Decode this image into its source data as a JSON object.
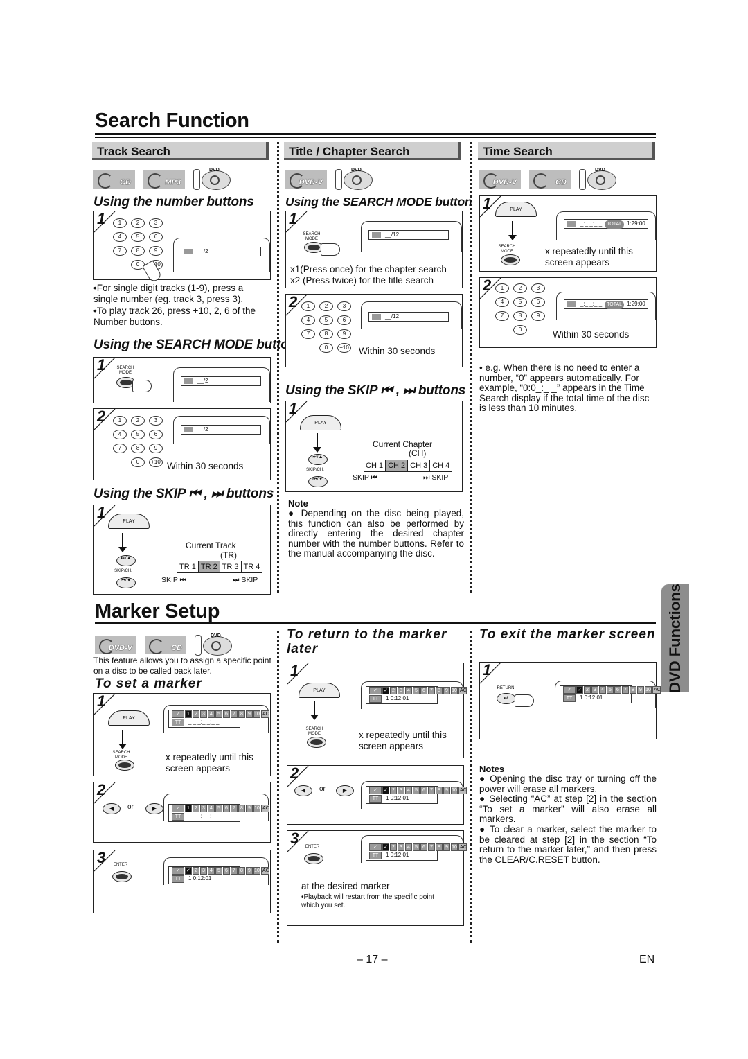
{
  "page": {
    "number": "– 17 –",
    "language": "EN",
    "side_tab": "DVD Functions"
  },
  "search_function": {
    "title": "Search Function",
    "track_search": {
      "header": "Track Search",
      "discs": [
        "CD",
        "MP3"
      ],
      "dvd_logo": "DVD",
      "number_buttons": {
        "heading": "Using the number buttons",
        "step1": {
          "num": "1",
          "osd": "__/2",
          "osd_icon": "TR"
        },
        "bullets": [
          "•For single digit tracks (1-9), press a single number (eg. track 3, press 3).",
          "•To play track 26, press +10, 2, 6 of the Number buttons."
        ]
      },
      "search_mode": {
        "heading": "Using the SEARCH MODE button",
        "step1": {
          "num": "1",
          "button": "SEARCH MODE",
          "osd": "__/2"
        },
        "step2": {
          "num": "2",
          "osd": "__/2",
          "caption": "Within 30 seconds"
        }
      },
      "skip": {
        "heading": "Using the SKIP ⏮ , ⏭ buttons",
        "step1": {
          "num": "1",
          "play_label": "PLAY",
          "skip_label": "SKIP/CH.",
          "current_label": "Current Track",
          "current_abbr": "(TR)",
          "cells": [
            "TR 1",
            "TR 2",
            "TR 3",
            "TR 4"
          ],
          "current_index": 1,
          "skip_back": "SKIP ⏮",
          "skip_fwd": "⏭ SKIP"
        }
      }
    },
    "title_chapter_search": {
      "header": "Title / Chapter Search",
      "discs": [
        "DVD-V"
      ],
      "dvd_logo": "DVD",
      "search_mode": {
        "heading": "Using the SEARCH MODE button",
        "step1": {
          "num": "1",
          "button": "SEARCH MODE",
          "osd": "__/12",
          "captions": [
            "x1(Press once) for the chapter search",
            "x2 (Press twice) for the title search"
          ]
        },
        "step2": {
          "num": "2",
          "osd": "__/12",
          "caption": "Within 30 seconds"
        }
      },
      "skip": {
        "heading": "Using the SKIP ⏮ , ⏭ buttons",
        "step1": {
          "num": "1",
          "play_label": "PLAY",
          "skip_label": "SKIP/CH.",
          "current_label": "Current Chapter",
          "current_abbr": "(CH)",
          "cells": [
            "CH 1",
            "CH 2",
            "CH 3",
            "CH 4"
          ],
          "current_index": 1,
          "skip_back": "SKIP ⏮",
          "skip_fwd": "⏭ SKIP"
        }
      },
      "note": {
        "title": "Note",
        "text": "● Depending on the disc being played, this function can also be performed by directly entering the desired chapter number with the number buttons. Refer to the manual accompanying the disc."
      }
    },
    "time_search": {
      "header": "Time Search",
      "discs": [
        "DVD-V",
        "CD"
      ],
      "dvd_logo": "DVD",
      "step1": {
        "num": "1",
        "play_label": "PLAY",
        "button": "SEARCH MODE",
        "osd_time": "_:_ _:_ _",
        "osd_total": "TOTAL",
        "osd_total_time": "1:29:00",
        "caption": "x repeatedly until this screen appears"
      },
      "step2": {
        "num": "2",
        "osd_time": "_:_ _:_ _",
        "osd_total": "TOTAL",
        "osd_total_time": "1:29:00",
        "caption": "Within 30 seconds"
      },
      "bullet": "• e.g. When there is no need to enter a number, “0” appears automatically. For example, “0:0_:_ _” appears in the Time Search display if the total time of the disc is less than 10 minutes."
    }
  },
  "marker_setup": {
    "title": "Marker Setup",
    "discs": [
      "DVD-V",
      "CD"
    ],
    "dvd_logo": "DVD",
    "intro": "This feature allows you to assign a specific point on a disc to be called back later.",
    "markers": [
      "1",
      "2",
      "3",
      "4",
      "5",
      "6",
      "7",
      "8",
      "9",
      "10"
    ],
    "ac_label": "AC",
    "tt_label": "TT",
    "set_marker": {
      "heading": "To set a marker",
      "step1": {
        "num": "1",
        "play_label": "PLAY",
        "button": "SEARCH MODE",
        "tt_value": "_ _ _:_ _:_ _",
        "caption": "x repeatedly until this screen appears"
      },
      "step2": {
        "num": "2",
        "or_label": "or",
        "tt_value": "_ _ _:_ _:_ _"
      },
      "step3": {
        "num": "3",
        "button": "ENTER",
        "tt_value": "1  0:12:01"
      }
    },
    "return_marker": {
      "heading": "To return to the marker later",
      "step1": {
        "num": "1",
        "play_label": "PLAY",
        "button": "SEARCH MODE",
        "tt_value": "1  0:12:01",
        "caption": "x repeatedly until this screen appears"
      },
      "step2": {
        "num": "2",
        "or_label": "or",
        "tt_value": "1  0:12:01"
      },
      "step3": {
        "num": "3",
        "button": "ENTER",
        "tt_value": "1  0:12:01",
        "caption": "at the desired marker",
        "bullet": "•Playback will restart from the specific point which you set."
      }
    },
    "exit_marker": {
      "heading": "To exit the marker screen",
      "step1": {
        "num": "1",
        "button": "RETURN",
        "tt_value": "1  0:12:01"
      },
      "notes_title": "Notes",
      "notes": [
        "● Opening the disc tray or turning off the power will erase all markers.",
        "● Selecting “AC” at step [2] in the section “To set a marker” will also erase all markers.",
        "● To clear a marker, select the marker to be cleared at step [2] in the section “To return to the marker later,” and then press the CLEAR/C.RESET button."
      ]
    }
  }
}
